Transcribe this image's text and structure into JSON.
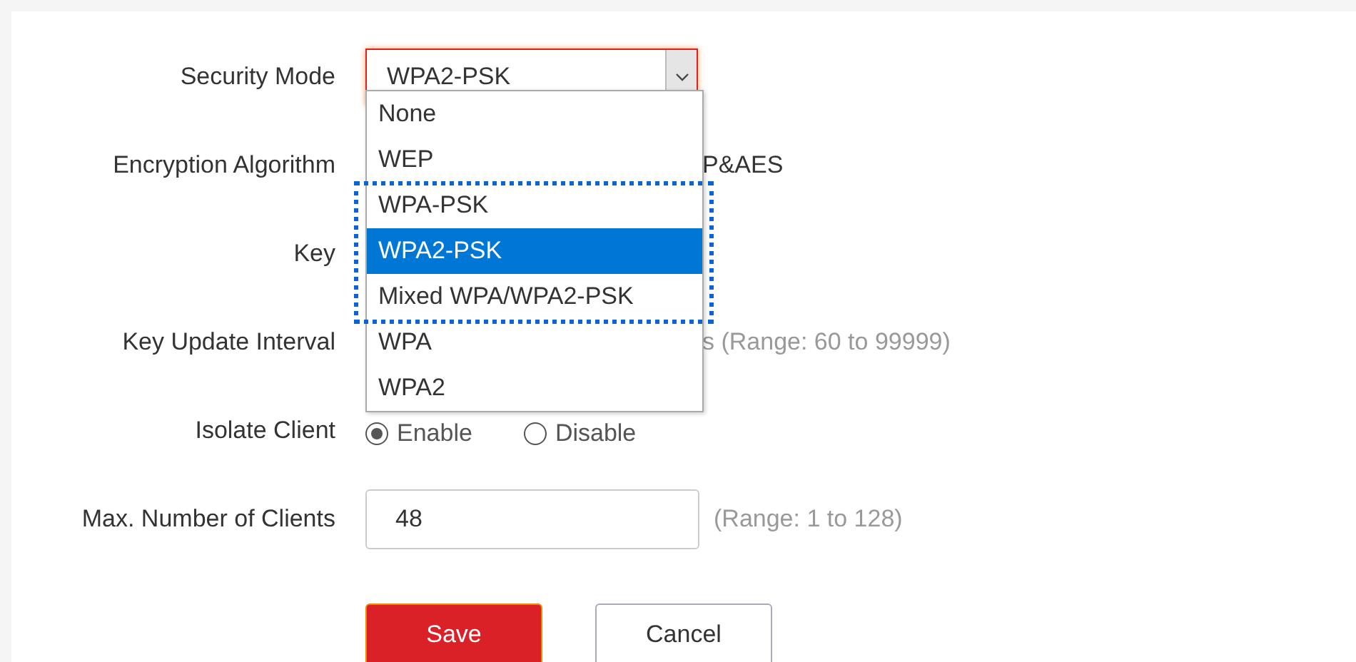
{
  "form": {
    "rows": [
      {
        "kind": "select",
        "label": "Security Mode",
        "value": "WPA2-PSK"
      },
      {
        "kind": "text",
        "label": "Encryption Algorithm",
        "value": "P&AES"
      },
      {
        "kind": "blank",
        "label": "Key"
      },
      {
        "kind": "text",
        "label": "Key Update Interval",
        "value": "s (Range: 60 to 99999)"
      },
      {
        "kind": "radio",
        "label": "Isolate Client",
        "options": [
          {
            "label": "Enable",
            "selected": true
          },
          {
            "label": "Disable",
            "selected": false
          }
        ]
      },
      {
        "kind": "input",
        "label": "Max. Number of Clients",
        "value": "48",
        "hint": "(Range: 1 to 128)"
      }
    ]
  },
  "dropdown": {
    "options": [
      {
        "label": "None",
        "selected": false,
        "highlighted": false
      },
      {
        "label": "WEP",
        "selected": false,
        "highlighted": false
      },
      {
        "label": "WPA-PSK",
        "selected": false,
        "highlighted": true
      },
      {
        "label": "WPA2-PSK",
        "selected": true,
        "highlighted": true
      },
      {
        "label": "Mixed WPA/WPA2-PSK",
        "selected": false,
        "highlighted": true
      },
      {
        "label": "WPA",
        "selected": false,
        "highlighted": false
      },
      {
        "label": "WPA2",
        "selected": false,
        "highlighted": false
      }
    ]
  },
  "buttons": [
    {
      "kind": "primary",
      "label": "Save"
    },
    {
      "kind": "secondary",
      "label": "Cancel"
    }
  ]
}
